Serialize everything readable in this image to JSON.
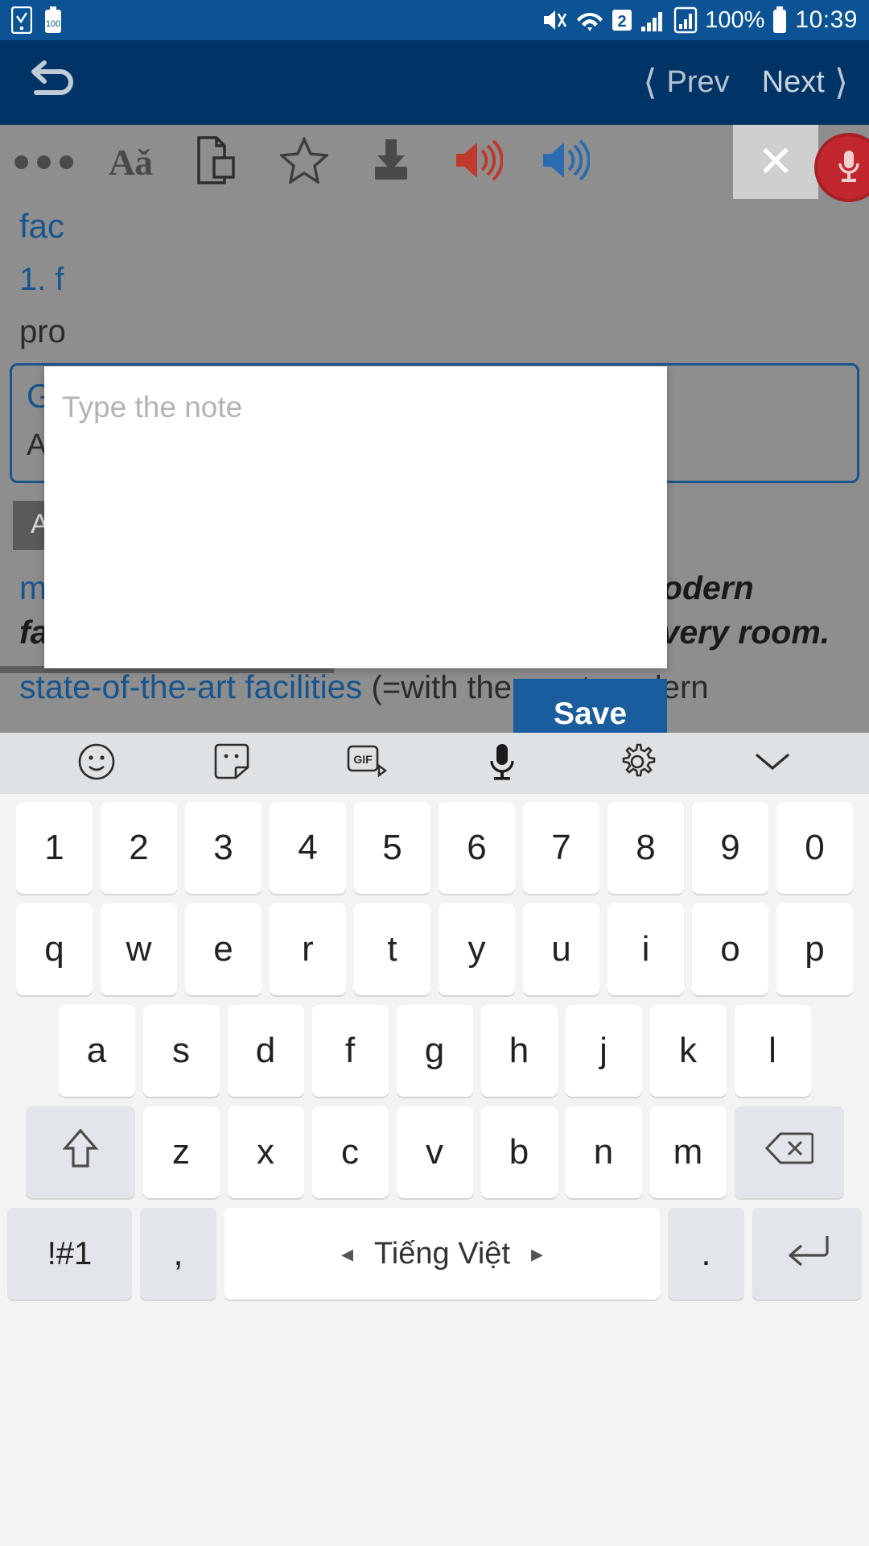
{
  "statusbar": {
    "time": "10:39",
    "battery_percent": "100%",
    "sim_badge": "2",
    "icons": [
      "checkbox-app-icon",
      "battery-saver-icon",
      "mute-vibrate-icon",
      "wifi-icon",
      "sim-2-icon",
      "signal-bars-icon",
      "signal-strength-icon",
      "battery-icon"
    ],
    "accent": "#0b5394"
  },
  "navbar": {
    "back_icon": "undo-arrow-icon",
    "prev_label": "Prev",
    "next_label": "Next",
    "background": "#003366"
  },
  "toolbar": {
    "items": [
      {
        "name": "more-options-icon",
        "label": "•••"
      },
      {
        "name": "font-size-icon",
        "label": "Aǎ"
      },
      {
        "name": "copy-document-icon",
        "label": ""
      },
      {
        "name": "favorite-star-icon",
        "label": ""
      },
      {
        "name": "download-icon",
        "label": ""
      },
      {
        "name": "speaker-us-icon",
        "label": ""
      },
      {
        "name": "speaker-uk-icon",
        "label": ""
      }
    ],
    "close_label": "✕",
    "mic_icon": "microphone-icon",
    "speaker_us_color": "#c0392b",
    "speaker_uk_color": "#2b6cb0"
  },
  "dictionary": {
    "headword": "fac",
    "sense_number": "1. f",
    "line3": "pro",
    "example_box": {
      "title": "G",
      "body": "Al"
    },
    "pos_tag": "AD",
    "entries": [
      {
        "term": "modern facilities",
        "example": "The Grand Hotel offers modern facilities and there is internet access in every room."
      },
      {
        "term": "state-of-the-art facilities",
        "example": "(=with the most modern"
      }
    ]
  },
  "note_dialog": {
    "placeholder": "Type the note",
    "value": "",
    "save_label": "Save",
    "save_color": "#1a5d9e"
  },
  "keyboard": {
    "toolbar_icons": [
      "emoji-icon",
      "sticker-icon",
      "gif-icon",
      "microphone-icon",
      "gear-icon",
      "chevron-down-icon"
    ],
    "gif_label": "GIF",
    "rows": [
      [
        "1",
        "2",
        "3",
        "4",
        "5",
        "6",
        "7",
        "8",
        "9",
        "0"
      ],
      [
        "q",
        "w",
        "e",
        "r",
        "t",
        "y",
        "u",
        "i",
        "o",
        "p"
      ],
      [
        "a",
        "s",
        "d",
        "f",
        "g",
        "h",
        "j",
        "k",
        "l"
      ],
      [
        "z",
        "x",
        "c",
        "v",
        "b",
        "n",
        "m"
      ]
    ],
    "shift_label": "⇧",
    "delete_label": "⌫",
    "symbols_label": "!#1",
    "comma_label": ",",
    "space_label": "Tiếng Việt",
    "space_left_arrow": "◂",
    "space_right_arrow": "▸",
    "period_label": ".",
    "enter_label": "↵"
  }
}
